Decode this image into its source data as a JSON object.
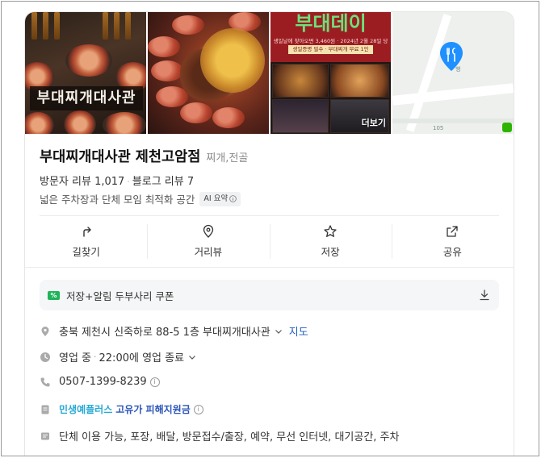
{
  "photos": {
    "photo1_sign": "부대찌개대사관",
    "photo3": {
      "title": "부대데이",
      "line1": "생일날에 찾아오면 3,460원 · 2024년 2월 28일 당일!",
      "line2": "생일증명 필수 · 부대찌개 무료 1인",
      "more_label": "더보기"
    },
    "map": {
      "label_street": "행",
      "label_number": "105"
    }
  },
  "place": {
    "name": "부대찌개대사관 제천고암점",
    "category": "찌개,전골",
    "visitor_reviews_label": "방문자 리뷰",
    "visitor_reviews_count": "1,017",
    "blog_reviews_label": "블로그 리뷰",
    "blog_reviews_count": "7",
    "summary": "넓은 주차장과 단체 모임 최적화 공간",
    "ai_badge": "AI 요약"
  },
  "actions": [
    {
      "label": "길찾기",
      "icon": "directions-icon"
    },
    {
      "label": "거리뷰",
      "icon": "location-pin-icon"
    },
    {
      "label": "저장",
      "icon": "star-icon"
    },
    {
      "label": "공유",
      "icon": "share-icon"
    }
  ],
  "coupon": {
    "label": "저장+알림 두부사리 쿠폰",
    "icon_text": "%"
  },
  "details": {
    "address": "충북 제천시 신죽하로 88-5 1층 부대찌개대사관",
    "map_link": "지도",
    "hours_status": "영업 중",
    "hours_detail": "22:00에 영업 종료",
    "phone": "0507-1399-8239",
    "program_name": "민생예플러스",
    "program_detail": "고유가 피해지원금",
    "amenities": "단체 이용 가능, 포장, 배달, 방문접수/출장, 예약, 무선 인터넷, 대기공간, 주차"
  },
  "colors": {
    "link_blue": "#1f5dbd",
    "map_pin": "#1e90ff",
    "coupon_green": "#1fb45a",
    "photo3_red": "#9b1d22"
  }
}
